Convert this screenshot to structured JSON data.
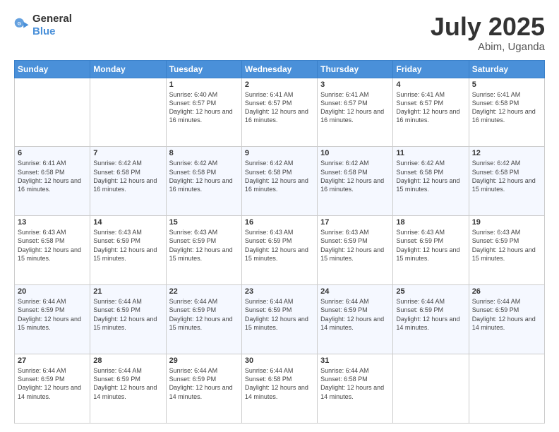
{
  "header": {
    "logo_general": "General",
    "logo_blue": "Blue",
    "title": "July 2025",
    "location": "Abim, Uganda"
  },
  "weekdays": [
    "Sunday",
    "Monday",
    "Tuesday",
    "Wednesday",
    "Thursday",
    "Friday",
    "Saturday"
  ],
  "weeks": [
    [
      {
        "day": "",
        "sunrise": "",
        "sunset": "",
        "daylight": "",
        "empty": true
      },
      {
        "day": "",
        "sunrise": "",
        "sunset": "",
        "daylight": "",
        "empty": true
      },
      {
        "day": "1",
        "sunrise": "Sunrise: 6:40 AM",
        "sunset": "Sunset: 6:57 PM",
        "daylight": "Daylight: 12 hours and 16 minutes.",
        "empty": false
      },
      {
        "day": "2",
        "sunrise": "Sunrise: 6:41 AM",
        "sunset": "Sunset: 6:57 PM",
        "daylight": "Daylight: 12 hours and 16 minutes.",
        "empty": false
      },
      {
        "day": "3",
        "sunrise": "Sunrise: 6:41 AM",
        "sunset": "Sunset: 6:57 PM",
        "daylight": "Daylight: 12 hours and 16 minutes.",
        "empty": false
      },
      {
        "day": "4",
        "sunrise": "Sunrise: 6:41 AM",
        "sunset": "Sunset: 6:57 PM",
        "daylight": "Daylight: 12 hours and 16 minutes.",
        "empty": false
      },
      {
        "day": "5",
        "sunrise": "Sunrise: 6:41 AM",
        "sunset": "Sunset: 6:58 PM",
        "daylight": "Daylight: 12 hours and 16 minutes.",
        "empty": false
      }
    ],
    [
      {
        "day": "6",
        "sunrise": "Sunrise: 6:41 AM",
        "sunset": "Sunset: 6:58 PM",
        "daylight": "Daylight: 12 hours and 16 minutes.",
        "empty": false
      },
      {
        "day": "7",
        "sunrise": "Sunrise: 6:42 AM",
        "sunset": "Sunset: 6:58 PM",
        "daylight": "Daylight: 12 hours and 16 minutes.",
        "empty": false
      },
      {
        "day": "8",
        "sunrise": "Sunrise: 6:42 AM",
        "sunset": "Sunset: 6:58 PM",
        "daylight": "Daylight: 12 hours and 16 minutes.",
        "empty": false
      },
      {
        "day": "9",
        "sunrise": "Sunrise: 6:42 AM",
        "sunset": "Sunset: 6:58 PM",
        "daylight": "Daylight: 12 hours and 16 minutes.",
        "empty": false
      },
      {
        "day": "10",
        "sunrise": "Sunrise: 6:42 AM",
        "sunset": "Sunset: 6:58 PM",
        "daylight": "Daylight: 12 hours and 16 minutes.",
        "empty": false
      },
      {
        "day": "11",
        "sunrise": "Sunrise: 6:42 AM",
        "sunset": "Sunset: 6:58 PM",
        "daylight": "Daylight: 12 hours and 15 minutes.",
        "empty": false
      },
      {
        "day": "12",
        "sunrise": "Sunrise: 6:42 AM",
        "sunset": "Sunset: 6:58 PM",
        "daylight": "Daylight: 12 hours and 15 minutes.",
        "empty": false
      }
    ],
    [
      {
        "day": "13",
        "sunrise": "Sunrise: 6:43 AM",
        "sunset": "Sunset: 6:58 PM",
        "daylight": "Daylight: 12 hours and 15 minutes.",
        "empty": false
      },
      {
        "day": "14",
        "sunrise": "Sunrise: 6:43 AM",
        "sunset": "Sunset: 6:59 PM",
        "daylight": "Daylight: 12 hours and 15 minutes.",
        "empty": false
      },
      {
        "day": "15",
        "sunrise": "Sunrise: 6:43 AM",
        "sunset": "Sunset: 6:59 PM",
        "daylight": "Daylight: 12 hours and 15 minutes.",
        "empty": false
      },
      {
        "day": "16",
        "sunrise": "Sunrise: 6:43 AM",
        "sunset": "Sunset: 6:59 PM",
        "daylight": "Daylight: 12 hours and 15 minutes.",
        "empty": false
      },
      {
        "day": "17",
        "sunrise": "Sunrise: 6:43 AM",
        "sunset": "Sunset: 6:59 PM",
        "daylight": "Daylight: 12 hours and 15 minutes.",
        "empty": false
      },
      {
        "day": "18",
        "sunrise": "Sunrise: 6:43 AM",
        "sunset": "Sunset: 6:59 PM",
        "daylight": "Daylight: 12 hours and 15 minutes.",
        "empty": false
      },
      {
        "day": "19",
        "sunrise": "Sunrise: 6:43 AM",
        "sunset": "Sunset: 6:59 PM",
        "daylight": "Daylight: 12 hours and 15 minutes.",
        "empty": false
      }
    ],
    [
      {
        "day": "20",
        "sunrise": "Sunrise: 6:44 AM",
        "sunset": "Sunset: 6:59 PM",
        "daylight": "Daylight: 12 hours and 15 minutes.",
        "empty": false
      },
      {
        "day": "21",
        "sunrise": "Sunrise: 6:44 AM",
        "sunset": "Sunset: 6:59 PM",
        "daylight": "Daylight: 12 hours and 15 minutes.",
        "empty": false
      },
      {
        "day": "22",
        "sunrise": "Sunrise: 6:44 AM",
        "sunset": "Sunset: 6:59 PM",
        "daylight": "Daylight: 12 hours and 15 minutes.",
        "empty": false
      },
      {
        "day": "23",
        "sunrise": "Sunrise: 6:44 AM",
        "sunset": "Sunset: 6:59 PM",
        "daylight": "Daylight: 12 hours and 15 minutes.",
        "empty": false
      },
      {
        "day": "24",
        "sunrise": "Sunrise: 6:44 AM",
        "sunset": "Sunset: 6:59 PM",
        "daylight": "Daylight: 12 hours and 14 minutes.",
        "empty": false
      },
      {
        "day": "25",
        "sunrise": "Sunrise: 6:44 AM",
        "sunset": "Sunset: 6:59 PM",
        "daylight": "Daylight: 12 hours and 14 minutes.",
        "empty": false
      },
      {
        "day": "26",
        "sunrise": "Sunrise: 6:44 AM",
        "sunset": "Sunset: 6:59 PM",
        "daylight": "Daylight: 12 hours and 14 minutes.",
        "empty": false
      }
    ],
    [
      {
        "day": "27",
        "sunrise": "Sunrise: 6:44 AM",
        "sunset": "Sunset: 6:59 PM",
        "daylight": "Daylight: 12 hours and 14 minutes.",
        "empty": false
      },
      {
        "day": "28",
        "sunrise": "Sunrise: 6:44 AM",
        "sunset": "Sunset: 6:59 PM",
        "daylight": "Daylight: 12 hours and 14 minutes.",
        "empty": false
      },
      {
        "day": "29",
        "sunrise": "Sunrise: 6:44 AM",
        "sunset": "Sunset: 6:59 PM",
        "daylight": "Daylight: 12 hours and 14 minutes.",
        "empty": false
      },
      {
        "day": "30",
        "sunrise": "Sunrise: 6:44 AM",
        "sunset": "Sunset: 6:58 PM",
        "daylight": "Daylight: 12 hours and 14 minutes.",
        "empty": false
      },
      {
        "day": "31",
        "sunrise": "Sunrise: 6:44 AM",
        "sunset": "Sunset: 6:58 PM",
        "daylight": "Daylight: 12 hours and 14 minutes.",
        "empty": false
      },
      {
        "day": "",
        "sunrise": "",
        "sunset": "",
        "daylight": "",
        "empty": true
      },
      {
        "day": "",
        "sunrise": "",
        "sunset": "",
        "daylight": "",
        "empty": true
      }
    ]
  ]
}
